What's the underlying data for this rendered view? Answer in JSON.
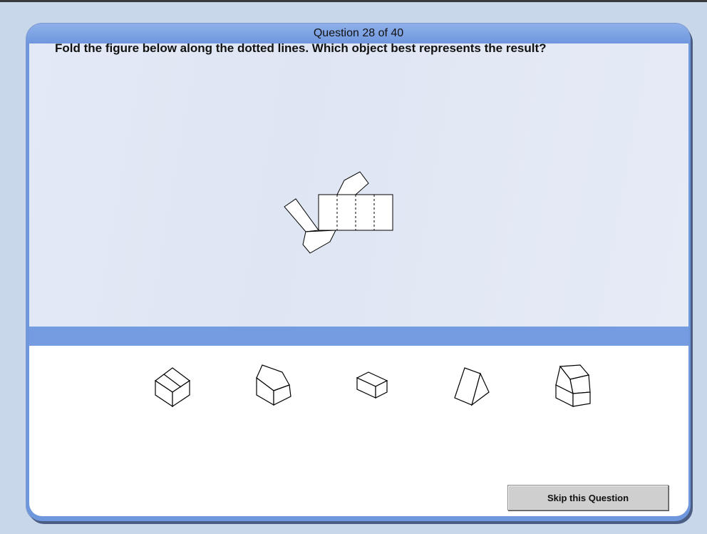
{
  "header": {
    "title": "Question  28 of 40"
  },
  "question": {
    "text": "Fold the figure below along the dotted lines. Which object best represents the result?"
  },
  "answers": {
    "options": [
      "option-1",
      "option-2",
      "option-3",
      "option-4",
      "option-5"
    ]
  },
  "footer": {
    "skip_label": "Skip this Question"
  },
  "colors": {
    "panel_blue": "#6f97de",
    "question_bg": "#e2e8f5",
    "answer_bg": "#ffffff",
    "button_gray": "#cfcfcf"
  }
}
